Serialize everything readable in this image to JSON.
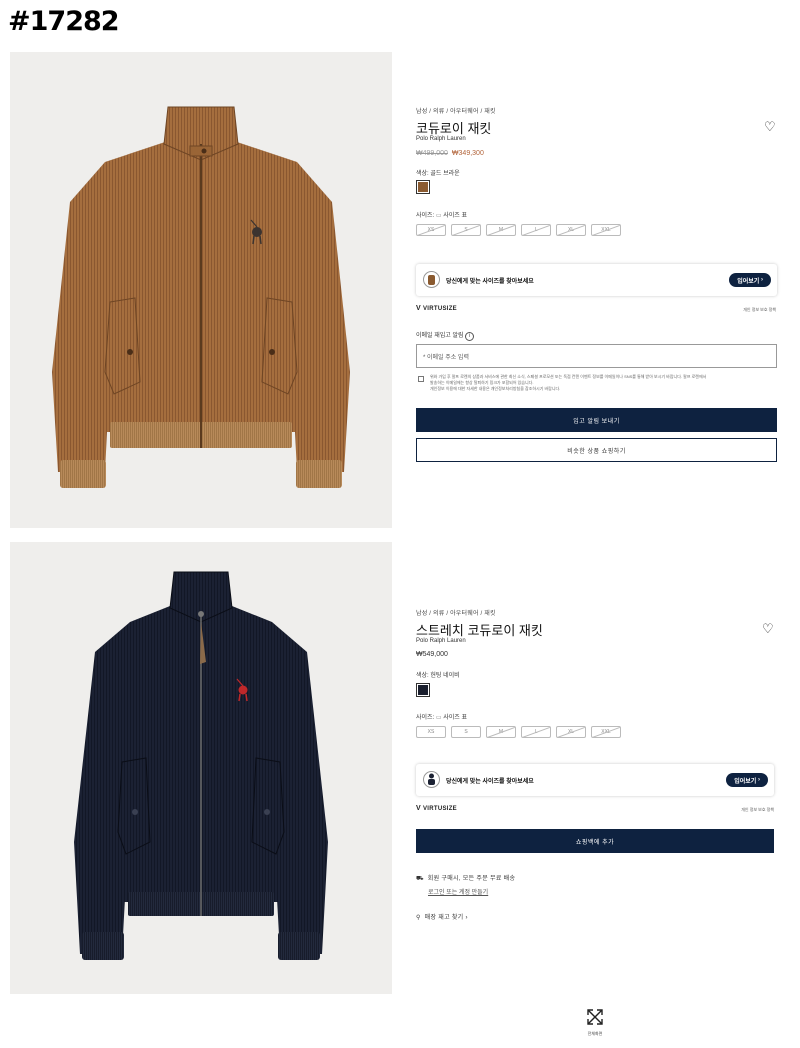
{
  "post_tag": "#17282",
  "product1": {
    "breadcrumb": "남성 / 의류 / 아우터웨어 / 재킷",
    "title": "코듀로이 재킷",
    "brand": "Polo Ralph Lauren",
    "price_original": "₩499,000",
    "price_sale": "₩349,300",
    "color_label": "색상: 골드 브라운",
    "swatch_color": "#8a5a30",
    "size_label": "사이즈:",
    "size_guide": "사이즈 표",
    "sizes": [
      "XS",
      "S",
      "M",
      "L",
      "XL",
      "XXL"
    ],
    "virtusize_prompt": "당신에게 맞는 사이즈를 찾아보세요",
    "virtusize_button": "입어보기",
    "virtusize_logo": "VIRTUSIZE",
    "privacy_link": "개인 정보 보호 정책",
    "restock_label": "이메일 재입고 알림",
    "email_placeholder": "* 이메일 주소 입력",
    "consent_text_1": "위와 가입 후 랄프 로렌의 상품과 서비스에 관한 최신 소식, 스페셜 프로모션 또는 독점 컨텐 이벤트 정보를 이메일이나 SNS를 통해 받아 보시기 바랍니다. 랄프 로렌에서",
    "consent_text_2": "발송하는 이메일에는 항상 탈퇴하기 링크가 포함되어 있습니다.",
    "consent_text_3": "개인정보 이용에 대한 자세한 내용은 개인정보처리방침을 참조하시기 바랍니다.",
    "notify_button": "입고 알림 보내기",
    "similar_button": "비슷한 상품 쇼핑하기"
  },
  "product2": {
    "breadcrumb": "남성 / 의류 / 아우터웨어 / 재킷",
    "title": "스트레치 코듀로이 재킷",
    "brand": "Polo Ralph Lauren",
    "price": "₩549,000",
    "color_label": "색상: 헌팅 네이비",
    "swatch_color": "#1a1f2e",
    "size_label": "사이즈:",
    "size_guide": "사이즈 표",
    "sizes": [
      "XS",
      "S",
      "M",
      "L",
      "XL",
      "XXL"
    ],
    "virtusize_prompt": "당신에게 맞는 사이즈를 찾아보세요",
    "virtusize_button": "입어보기",
    "virtusize_logo": "VIRTUSIZE",
    "privacy_link": "개인 정보 보호 정책",
    "add_to_bag": "쇼핑백에 추가",
    "shipping_promo": "회원 구매시, 모든 주문 무료 배송",
    "login_link": "로그인 또는 계정 만들기",
    "store_finder": "매장 재고 찾기"
  },
  "fullscreen_label": "전체화면",
  "colors": {
    "navy": "#0e2240",
    "sale": "#b2643a",
    "corduroy_brown": "#a56e3e",
    "corduroy_navy": "#1b2133",
    "pony_red": "#c0282a"
  }
}
